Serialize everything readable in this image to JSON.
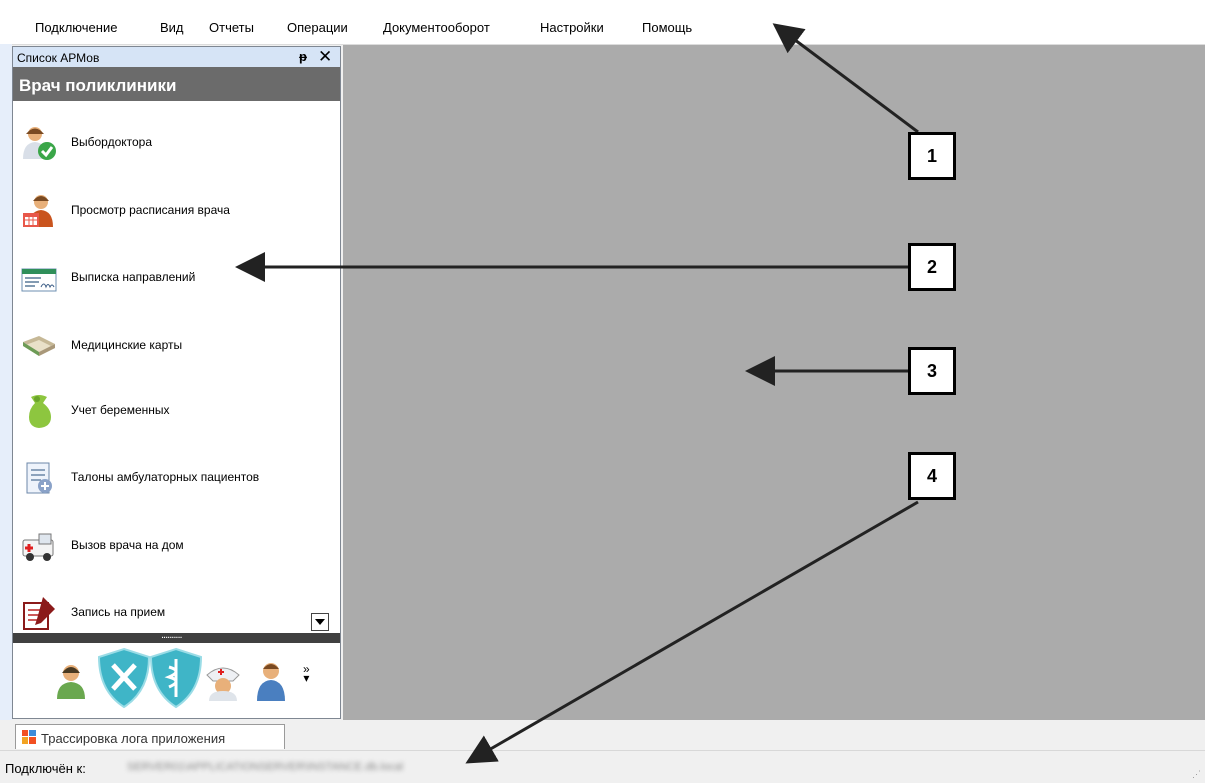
{
  "menu": {
    "items": [
      {
        "label": "Подключение"
      },
      {
        "label": "Вид"
      },
      {
        "label": "Отчеты"
      },
      {
        "label": "Операции"
      },
      {
        "label": "Документооборот"
      },
      {
        "label": "Настройки"
      },
      {
        "label": "Помощь"
      }
    ]
  },
  "panel": {
    "title": "Список АРМов",
    "pin_glyph": "ᵽ",
    "close_glyph": "✕",
    "group_title": "Врач поликлиники",
    "items": [
      {
        "label": "Выбордоктора",
        "icon": "doctor-check-icon"
      },
      {
        "label": "Просмотр расписания врача",
        "icon": "doctor-schedule-icon"
      },
      {
        "label": "Выписка направлений",
        "icon": "referral-form-icon"
      },
      {
        "label": "Медицинские карты",
        "icon": "medical-cards-icon"
      },
      {
        "label": "Учет беременных",
        "icon": "pregnancy-icon"
      },
      {
        "label": "Талоны амбулаторных пациентов",
        "icon": "outpatient-coupon-icon"
      },
      {
        "label": "Вызов врача на дом",
        "icon": "ambulance-icon"
      },
      {
        "label": "Запись на прием",
        "icon": "appointment-icon"
      }
    ],
    "splitter_dots": "..........",
    "overflow_glyph": "»"
  },
  "tabs": [
    {
      "label": "Трассировка лога приложения"
    }
  ],
  "status": {
    "label": "Подключён к:",
    "value": "SERVER01\\APPLICATIONSERVER\\INSTANCE.db.local"
  },
  "callouts": [
    "1",
    "2",
    "3",
    "4"
  ],
  "colors": {
    "workspace": "#ababab",
    "panel_titlebar": "#d6e4f6",
    "group_header": "#6b6b6b"
  }
}
